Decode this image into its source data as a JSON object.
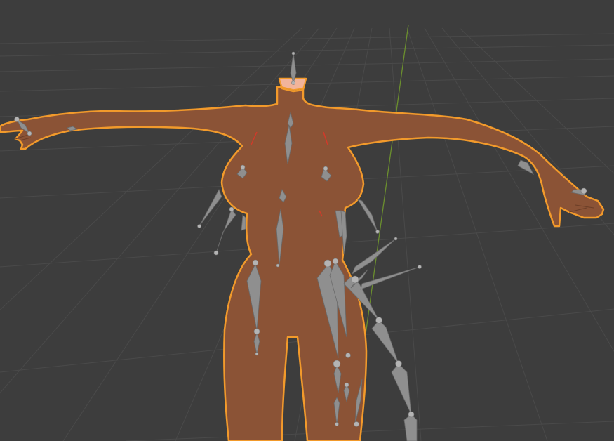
{
  "viewport": {
    "background": "#3d3d3d",
    "grid_color": "#4a4a4a",
    "y_axis_color": "#6b8f2e"
  },
  "mesh": {
    "fill": "#8b5336",
    "outline": "#f29a2b",
    "selected": true
  },
  "armature": {
    "bone_color": "#8f8f8f",
    "bone_edge": "#6a6a6a",
    "joint_color": "#b4b4b4"
  },
  "markers": {
    "red_line_color": "#d23a2a"
  }
}
